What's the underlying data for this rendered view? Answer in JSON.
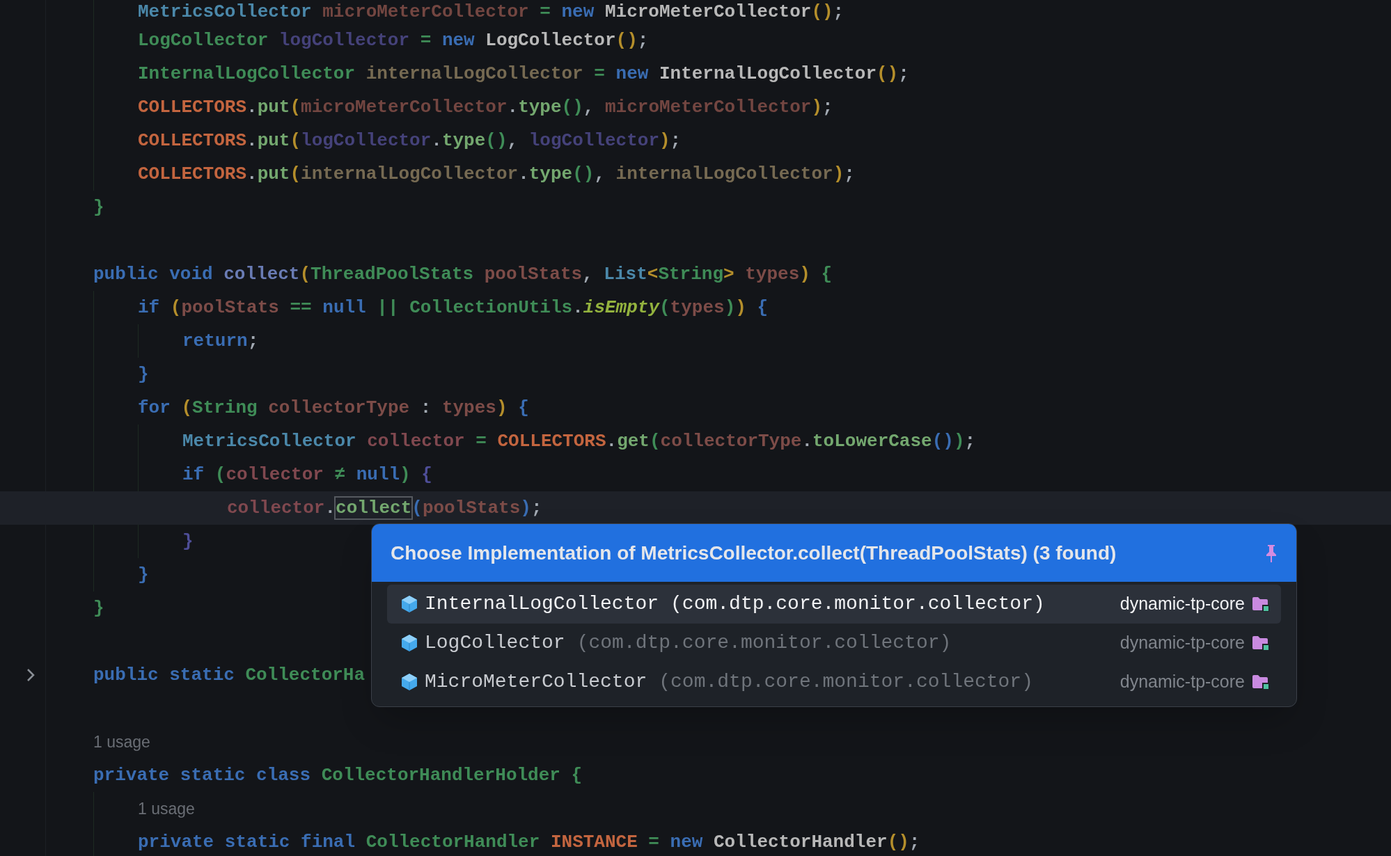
{
  "editor": {
    "lines": [
      {
        "kind": "block",
        "children": [
          {
            "kind": "code",
            "current": false,
            "tokens": [
              {
                "text": "MetricsCollector ",
                "kind": "iface"
              },
              {
                "text": "microMeterCollector",
                "kind": "v1"
              },
              {
                "text": " = ",
                "kind": "op"
              },
              {
                "text": "new ",
                "kind": "kw"
              },
              {
                "text": "MicroMeterCollector",
                "kind": "ctor"
              },
              {
                "text": "()",
                "kind": "p1"
              },
              {
                "text": ";",
                "kind": "punct"
              }
            ]
          },
          {
            "kind": "code",
            "current": false,
            "tokens": [
              {
                "text": "LogCollector ",
                "kind": "type"
              },
              {
                "text": "logCollector",
                "kind": "v2"
              },
              {
                "text": " = ",
                "kind": "op"
              },
              {
                "text": "new ",
                "kind": "kw"
              },
              {
                "text": "LogCollector",
                "kind": "ctor"
              },
              {
                "text": "()",
                "kind": "p1"
              },
              {
                "text": ";",
                "kind": "punct"
              }
            ]
          },
          {
            "kind": "code",
            "current": false,
            "tokens": [
              {
                "text": "InternalLogCollector ",
                "kind": "type"
              },
              {
                "text": "internalLogCollector",
                "kind": "v3"
              },
              {
                "text": " = ",
                "kind": "op"
              },
              {
                "text": "new ",
                "kind": "kw"
              },
              {
                "text": "InternalLogCollector",
                "kind": "ctor"
              },
              {
                "text": "()",
                "kind": "p1"
              },
              {
                "text": ";",
                "kind": "punct"
              }
            ]
          },
          {
            "kind": "code",
            "current": false,
            "tokens": [
              {
                "text": "COLLECTORS",
                "kind": "const"
              },
              {
                "text": ".",
                "kind": "punct"
              },
              {
                "text": "put",
                "kind": "call"
              },
              {
                "text": "(",
                "kind": "p1"
              },
              {
                "text": "microMeterCollector",
                "kind": "v1"
              },
              {
                "text": ".",
                "kind": "punct"
              },
              {
                "text": "type",
                "kind": "call"
              },
              {
                "text": "()",
                "kind": "p2"
              },
              {
                "text": ", ",
                "kind": "punct"
              },
              {
                "text": "microMeterCollector",
                "kind": "v1"
              },
              {
                "text": ")",
                "kind": "p1"
              },
              {
                "text": ";",
                "kind": "punct"
              }
            ]
          },
          {
            "kind": "code",
            "current": false,
            "tokens": [
              {
                "text": "COLLECTORS",
                "kind": "const"
              },
              {
                "text": ".",
                "kind": "punct"
              },
              {
                "text": "put",
                "kind": "call"
              },
              {
                "text": "(",
                "kind": "p1"
              },
              {
                "text": "logCollector",
                "kind": "v2"
              },
              {
                "text": ".",
                "kind": "punct"
              },
              {
                "text": "type",
                "kind": "call"
              },
              {
                "text": "()",
                "kind": "p2"
              },
              {
                "text": ", ",
                "kind": "punct"
              },
              {
                "text": "logCollector",
                "kind": "v2"
              },
              {
                "text": ")",
                "kind": "p1"
              },
              {
                "text": ";",
                "kind": "punct"
              }
            ]
          },
          {
            "kind": "code",
            "current": false,
            "tokens": [
              {
                "text": "COLLECTORS",
                "kind": "const"
              },
              {
                "text": ".",
                "kind": "punct"
              },
              {
                "text": "put",
                "kind": "call"
              },
              {
                "text": "(",
                "kind": "p1"
              },
              {
                "text": "internalLogCollector",
                "kind": "v3"
              },
              {
                "text": ".",
                "kind": "punct"
              },
              {
                "text": "type",
                "kind": "call"
              },
              {
                "text": "()",
                "kind": "p2"
              },
              {
                "text": ", ",
                "kind": "punct"
              },
              {
                "text": "internalLogCollector",
                "kind": "v3"
              },
              {
                "text": ")",
                "kind": "p1"
              },
              {
                "text": ";",
                "kind": "punct"
              }
            ]
          }
        ]
      },
      {
        "kind": "code",
        "current": false,
        "tokens": [
          {
            "text": "}",
            "kind": "p2"
          }
        ]
      },
      {
        "kind": "blank",
        "current": false
      },
      {
        "kind": "code",
        "current": false,
        "tokens": [
          {
            "text": "public ",
            "kind": "kw"
          },
          {
            "text": "void ",
            "kind": "kw"
          },
          {
            "text": "collect",
            "kind": "decl"
          },
          {
            "text": "(",
            "kind": "p1"
          },
          {
            "text": "ThreadPoolStats ",
            "kind": "type"
          },
          {
            "text": "poolStats",
            "kind": "param"
          },
          {
            "text": ", ",
            "kind": "punct"
          },
          {
            "text": "List",
            "kind": "iface"
          },
          {
            "text": "<",
            "kind": "p1"
          },
          {
            "text": "String",
            "kind": "type"
          },
          {
            "text": ">",
            "kind": "p1"
          },
          {
            "text": " types",
            "kind": "param"
          },
          {
            "text": ")",
            "kind": "p1"
          },
          {
            "text": " {",
            "kind": "p2"
          }
        ],
        "children": [
          {
            "kind": "code",
            "current": false,
            "tokens": [
              {
                "text": "if ",
                "kind": "kw"
              },
              {
                "text": "(",
                "kind": "p1"
              },
              {
                "text": "poolStats",
                "kind": "param"
              },
              {
                "text": " == ",
                "kind": "op"
              },
              {
                "text": "null",
                "kind": "kw"
              },
              {
                "text": " || ",
                "kind": "op"
              },
              {
                "text": "CollectionUtils",
                "kind": "type"
              },
              {
                "text": ".",
                "kind": "punct"
              },
              {
                "text": "isEmpty",
                "kind": "static"
              },
              {
                "text": "(",
                "kind": "p2"
              },
              {
                "text": "types",
                "kind": "param"
              },
              {
                "text": ")",
                "kind": "p2"
              },
              {
                "text": ")",
                "kind": "p1"
              },
              {
                "text": " {",
                "kind": "p3"
              }
            ],
            "children": [
              {
                "kind": "code",
                "current": false,
                "tokens": [
                  {
                    "text": "return",
                    "kind": "kw"
                  },
                  {
                    "text": ";",
                    "kind": "punct"
                  }
                ]
              }
            ]
          },
          {
            "kind": "code",
            "current": false,
            "tokens": [
              {
                "text": "}",
                "kind": "p3"
              }
            ]
          },
          {
            "kind": "code",
            "current": false,
            "tokens": [
              {
                "text": "for ",
                "kind": "kw"
              },
              {
                "text": "(",
                "kind": "p1"
              },
              {
                "text": "String ",
                "kind": "type"
              },
              {
                "text": "collectorType",
                "kind": "param"
              },
              {
                "text": " : ",
                "kind": "punct"
              },
              {
                "text": "types",
                "kind": "param"
              },
              {
                "text": ")",
                "kind": "p1"
              },
              {
                "text": " {",
                "kind": "p3"
              }
            ],
            "children": [
              {
                "kind": "code",
                "current": false,
                "tokens": [
                  {
                    "text": "MetricsCollector ",
                    "kind": "iface"
                  },
                  {
                    "text": "collector",
                    "kind": "v4"
                  },
                  {
                    "text": " = ",
                    "kind": "op"
                  },
                  {
                    "text": "COLLECTORS",
                    "kind": "const"
                  },
                  {
                    "text": ".",
                    "kind": "punct"
                  },
                  {
                    "text": "get",
                    "kind": "call"
                  },
                  {
                    "text": "(",
                    "kind": "p2"
                  },
                  {
                    "text": "collectorType",
                    "kind": "param"
                  },
                  {
                    "text": ".",
                    "kind": "punct"
                  },
                  {
                    "text": "toLowerCase",
                    "kind": "call"
                  },
                  {
                    "text": "()",
                    "kind": "p3"
                  },
                  {
                    "text": ")",
                    "kind": "p2"
                  },
                  {
                    "text": ";",
                    "kind": "punct"
                  }
                ]
              },
              {
                "kind": "code",
                "current": false,
                "tokens": [
                  {
                    "text": "if ",
                    "kind": "kw"
                  },
                  {
                    "text": "(",
                    "kind": "p2"
                  },
                  {
                    "text": "collector",
                    "kind": "v4"
                  },
                  {
                    "text": " ≠ ",
                    "kind": "op"
                  },
                  {
                    "text": "null",
                    "kind": "kw"
                  },
                  {
                    "text": ")",
                    "kind": "p2"
                  },
                  {
                    "text": " {",
                    "kind": "p4"
                  }
                ],
                "children": [
                  {
                    "kind": "code",
                    "current": true,
                    "tokens": [
                      {
                        "text": "collector",
                        "kind": "v4"
                      },
                      {
                        "text": ".",
                        "kind": "punct"
                      },
                      {
                        "text": "collect",
                        "kind": "match"
                      },
                      {
                        "text": "(",
                        "kind": "p3"
                      },
                      {
                        "text": "poolStats",
                        "kind": "param"
                      },
                      {
                        "text": ")",
                        "kind": "p3"
                      },
                      {
                        "text": ";",
                        "kind": "punct"
                      }
                    ]
                  }
                ]
              },
              {
                "kind": "code",
                "current": false,
                "tokens": [
                  {
                    "text": "}",
                    "kind": "p4"
                  }
                ]
              }
            ]
          },
          {
            "kind": "code",
            "current": false,
            "tokens": [
              {
                "text": "}",
                "kind": "p3"
              }
            ]
          }
        ]
      },
      {
        "kind": "code",
        "current": false,
        "tokens": [
          {
            "text": "}",
            "kind": "p2"
          }
        ]
      },
      {
        "kind": "blank",
        "current": false
      },
      {
        "kind": "folded",
        "current": false,
        "tokens": [
          {
            "text": "public ",
            "kind": "kw"
          },
          {
            "text": "static ",
            "kind": "kw"
          },
          {
            "text": "CollectorHa",
            "kind": "type"
          }
        ]
      },
      {
        "kind": "blank",
        "current": false
      },
      {
        "kind": "hint",
        "current": false,
        "tokens": [
          {
            "text": "1 usage",
            "kind": "hint"
          }
        ]
      },
      {
        "kind": "code",
        "current": false,
        "tokens": [
          {
            "text": "private ",
            "kind": "kw"
          },
          {
            "text": "static ",
            "kind": "kw"
          },
          {
            "text": "class ",
            "kind": "kw"
          },
          {
            "text": "CollectorHandlerHolder",
            "kind": "type"
          },
          {
            "text": " {",
            "kind": "p2"
          }
        ],
        "children": [
          {
            "kind": "hint",
            "current": false,
            "tokens": [
              {
                "text": "1 usage",
                "kind": "hint"
              }
            ]
          },
          {
            "kind": "code",
            "current": false,
            "tokens": [
              {
                "text": "private ",
                "kind": "kw"
              },
              {
                "text": "static ",
                "kind": "kw"
              },
              {
                "text": "final ",
                "kind": "kw"
              },
              {
                "text": "CollectorHandler ",
                "kind": "type"
              },
              {
                "text": "INSTANCE",
                "kind": "const"
              },
              {
                "text": " = ",
                "kind": "op"
              },
              {
                "text": "new ",
                "kind": "kw"
              },
              {
                "text": "CollectorHandler",
                "kind": "ctor"
              },
              {
                "text": "()",
                "kind": "p1"
              },
              {
                "text": ";",
                "kind": "punct"
              }
            ]
          }
        ]
      }
    ]
  },
  "popup": {
    "title": "Choose Implementation of MetricsCollector.collect(ThreadPoolStats) (3 found)",
    "pinned": true,
    "items": [
      {
        "name": "InternalLogCollector",
        "package": "(com.dtp.core.monitor.collector)",
        "module": "dynamic-tp-core",
        "selected": true
      },
      {
        "name": "LogCollector",
        "package": "(com.dtp.core.monitor.collector)",
        "module": "dynamic-tp-core",
        "selected": false
      },
      {
        "name": "MicroMeterCollector",
        "package": "(com.dtp.core.monitor.collector)",
        "module": "dynamic-tp-core",
        "selected": false
      }
    ]
  }
}
